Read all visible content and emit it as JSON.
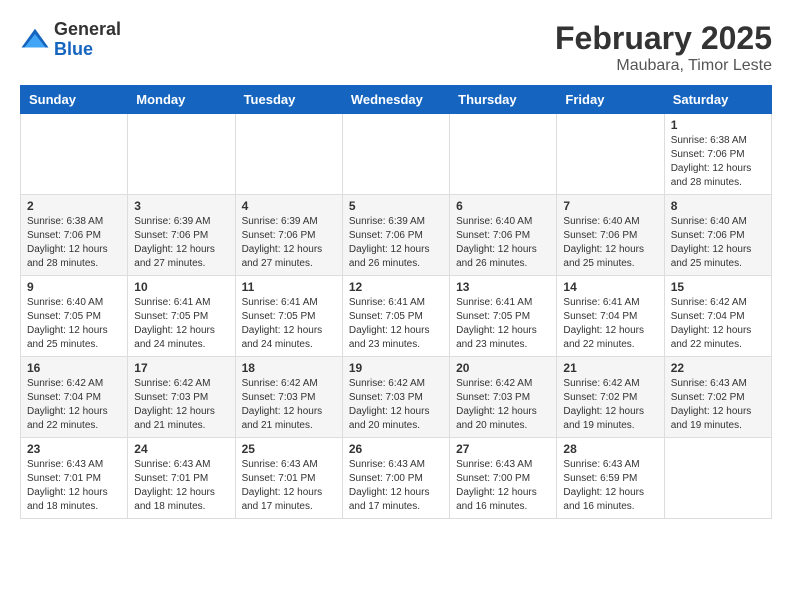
{
  "header": {
    "logo_general": "General",
    "logo_blue": "Blue",
    "month_title": "February 2025",
    "location": "Maubara, Timor Leste"
  },
  "days_of_week": [
    "Sunday",
    "Monday",
    "Tuesday",
    "Wednesday",
    "Thursday",
    "Friday",
    "Saturday"
  ],
  "weeks": [
    [
      {
        "day": "",
        "info": ""
      },
      {
        "day": "",
        "info": ""
      },
      {
        "day": "",
        "info": ""
      },
      {
        "day": "",
        "info": ""
      },
      {
        "day": "",
        "info": ""
      },
      {
        "day": "",
        "info": ""
      },
      {
        "day": "1",
        "info": "Sunrise: 6:38 AM\nSunset: 7:06 PM\nDaylight: 12 hours\nand 28 minutes."
      }
    ],
    [
      {
        "day": "2",
        "info": "Sunrise: 6:38 AM\nSunset: 7:06 PM\nDaylight: 12 hours\nand 28 minutes."
      },
      {
        "day": "3",
        "info": "Sunrise: 6:39 AM\nSunset: 7:06 PM\nDaylight: 12 hours\nand 27 minutes."
      },
      {
        "day": "4",
        "info": "Sunrise: 6:39 AM\nSunset: 7:06 PM\nDaylight: 12 hours\nand 27 minutes."
      },
      {
        "day": "5",
        "info": "Sunrise: 6:39 AM\nSunset: 7:06 PM\nDaylight: 12 hours\nand 26 minutes."
      },
      {
        "day": "6",
        "info": "Sunrise: 6:40 AM\nSunset: 7:06 PM\nDaylight: 12 hours\nand 26 minutes."
      },
      {
        "day": "7",
        "info": "Sunrise: 6:40 AM\nSunset: 7:06 PM\nDaylight: 12 hours\nand 25 minutes."
      },
      {
        "day": "8",
        "info": "Sunrise: 6:40 AM\nSunset: 7:06 PM\nDaylight: 12 hours\nand 25 minutes."
      }
    ],
    [
      {
        "day": "9",
        "info": "Sunrise: 6:40 AM\nSunset: 7:05 PM\nDaylight: 12 hours\nand 25 minutes."
      },
      {
        "day": "10",
        "info": "Sunrise: 6:41 AM\nSunset: 7:05 PM\nDaylight: 12 hours\nand 24 minutes."
      },
      {
        "day": "11",
        "info": "Sunrise: 6:41 AM\nSunset: 7:05 PM\nDaylight: 12 hours\nand 24 minutes."
      },
      {
        "day": "12",
        "info": "Sunrise: 6:41 AM\nSunset: 7:05 PM\nDaylight: 12 hours\nand 23 minutes."
      },
      {
        "day": "13",
        "info": "Sunrise: 6:41 AM\nSunset: 7:05 PM\nDaylight: 12 hours\nand 23 minutes."
      },
      {
        "day": "14",
        "info": "Sunrise: 6:41 AM\nSunset: 7:04 PM\nDaylight: 12 hours\nand 22 minutes."
      },
      {
        "day": "15",
        "info": "Sunrise: 6:42 AM\nSunset: 7:04 PM\nDaylight: 12 hours\nand 22 minutes."
      }
    ],
    [
      {
        "day": "16",
        "info": "Sunrise: 6:42 AM\nSunset: 7:04 PM\nDaylight: 12 hours\nand 22 minutes."
      },
      {
        "day": "17",
        "info": "Sunrise: 6:42 AM\nSunset: 7:03 PM\nDaylight: 12 hours\nand 21 minutes."
      },
      {
        "day": "18",
        "info": "Sunrise: 6:42 AM\nSunset: 7:03 PM\nDaylight: 12 hours\nand 21 minutes."
      },
      {
        "day": "19",
        "info": "Sunrise: 6:42 AM\nSunset: 7:03 PM\nDaylight: 12 hours\nand 20 minutes."
      },
      {
        "day": "20",
        "info": "Sunrise: 6:42 AM\nSunset: 7:03 PM\nDaylight: 12 hours\nand 20 minutes."
      },
      {
        "day": "21",
        "info": "Sunrise: 6:42 AM\nSunset: 7:02 PM\nDaylight: 12 hours\nand 19 minutes."
      },
      {
        "day": "22",
        "info": "Sunrise: 6:43 AM\nSunset: 7:02 PM\nDaylight: 12 hours\nand 19 minutes."
      }
    ],
    [
      {
        "day": "23",
        "info": "Sunrise: 6:43 AM\nSunset: 7:01 PM\nDaylight: 12 hours\nand 18 minutes."
      },
      {
        "day": "24",
        "info": "Sunrise: 6:43 AM\nSunset: 7:01 PM\nDaylight: 12 hours\nand 18 minutes."
      },
      {
        "day": "25",
        "info": "Sunrise: 6:43 AM\nSunset: 7:01 PM\nDaylight: 12 hours\nand 17 minutes."
      },
      {
        "day": "26",
        "info": "Sunrise: 6:43 AM\nSunset: 7:00 PM\nDaylight: 12 hours\nand 17 minutes."
      },
      {
        "day": "27",
        "info": "Sunrise: 6:43 AM\nSunset: 7:00 PM\nDaylight: 12 hours\nand 16 minutes."
      },
      {
        "day": "28",
        "info": "Sunrise: 6:43 AM\nSunset: 6:59 PM\nDaylight: 12 hours\nand 16 minutes."
      },
      {
        "day": "",
        "info": ""
      }
    ]
  ]
}
